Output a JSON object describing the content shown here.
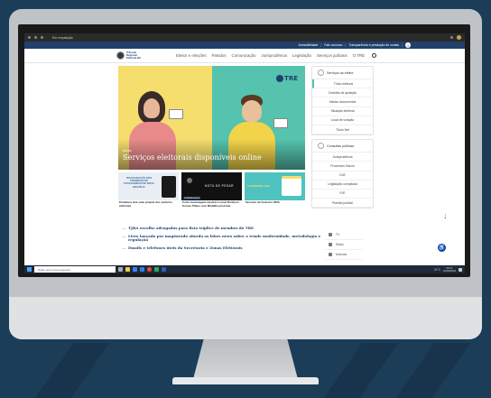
{
  "browser": {
    "tab_title": "Em requisição",
    "url": ""
  },
  "topbar": {
    "links": [
      "Acessibilidade",
      "Fale conosco",
      "Transparência e prestação de contas"
    ],
    "info_label": "i"
  },
  "logo": {
    "text": "Tribunal Regional Eleitoral-BA"
  },
  "nav": {
    "links": [
      "Eleitor e eleições",
      "Partidos",
      "Comunicação",
      "Jurisprudência",
      "Legislação",
      "Serviços judiciais",
      "O TRE"
    ]
  },
  "hero": {
    "kicker": "BRASIL",
    "headline": "Serviços eleitorais disponíveis online",
    "logo_text": "TRE",
    "colors": {
      "left": "#f5dd6e",
      "right": "#55c3ad"
    }
  },
  "cards": [
    {
      "thumb_text": "INAUGURAÇÃO DOS TERMINAIS DE PASSAGEIROS DE NOVA BRASÍLIA",
      "title": "Prefeitura terá sede própria dos cartórios eleitorais",
      "tag": ""
    },
    {
      "thumb_text": "NOTA DE PESAR",
      "title": "Corte homenageia mesário Leonel Ronilson Gomes Plaino com Medalha póstuma",
      "tag": "COMUNICAÇÃO"
    },
    {
      "thumb_text": "FEVEREIRO 2023",
      "title": "Sessões de fevereiro 2023",
      "tag": ""
    }
  ],
  "sidebar": {
    "services": {
      "title": "Serviços ao eleitor",
      "items": [
        "Título eleitoral",
        "Certidão de quitação",
        "Validar documentos",
        "Situação eleitoral",
        "Local de votação",
        "Título Net"
      ]
    },
    "queries": {
      "title": "Consultas públicas",
      "items": [
        "Jurisprudência",
        "Processos físicos",
        "DJE",
        "Legislação compilada",
        "PJE",
        "Plantão judicial"
      ]
    }
  },
  "news": [
    "TJBA escolhe advogados para lista tríplice de membro do TRE",
    "Livro lançado por magistrado aborda as fakes news sobre a tríade modernidade, metodologia e regulação",
    "Emails e telefones úteis da Secretaria e Zonas Eleitorais"
  ],
  "media": [
    "TV",
    "Rádio",
    "Notícias"
  ],
  "taskbar": {
    "search_placeholder": "Digite aqui para pesquisar",
    "temperature": "31°C",
    "time": "09:17",
    "date": "01/02/2023"
  }
}
